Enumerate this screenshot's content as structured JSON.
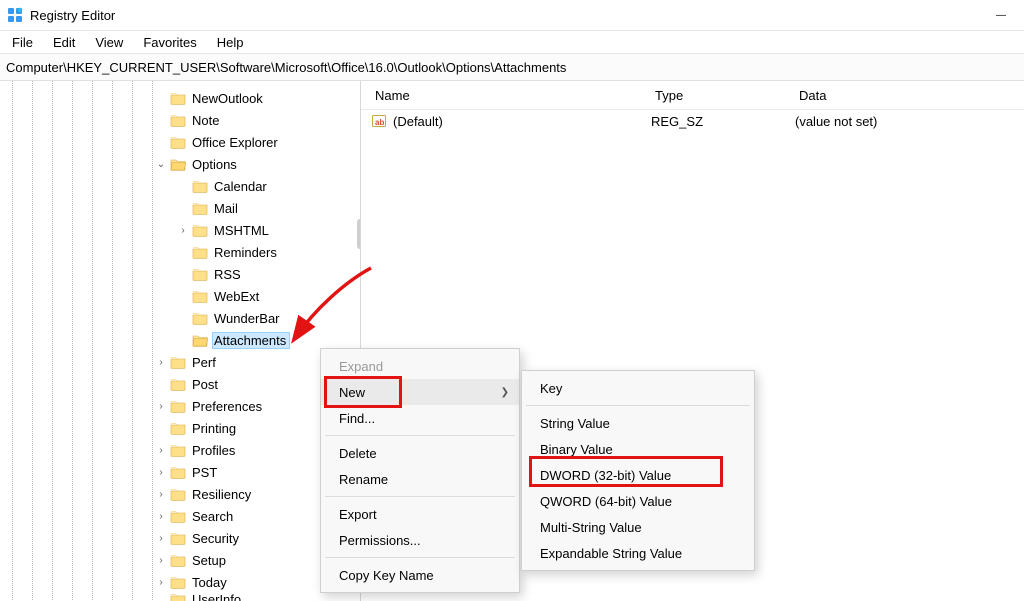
{
  "window": {
    "title": "Registry Editor"
  },
  "menubar": {
    "file": "File",
    "edit": "Edit",
    "view": "View",
    "favorites": "Favorites",
    "help": "Help"
  },
  "address": "Computer\\HKEY_CURRENT_USER\\Software\\Microsoft\\Office\\16.0\\Outlook\\Options\\Attachments",
  "tree": {
    "items": [
      {
        "label": "NewOutlook",
        "indent": 168,
        "exp": ""
      },
      {
        "label": "Note",
        "indent": 168,
        "exp": ""
      },
      {
        "label": "Office Explorer",
        "indent": 168,
        "exp": ""
      },
      {
        "label": "Options",
        "indent": 168,
        "exp": "v",
        "open": true
      },
      {
        "label": "Calendar",
        "indent": 190,
        "exp": ""
      },
      {
        "label": "Mail",
        "indent": 190,
        "exp": ""
      },
      {
        "label": "MSHTML",
        "indent": 190,
        "exp": ">"
      },
      {
        "label": "Reminders",
        "indent": 190,
        "exp": ""
      },
      {
        "label": "RSS",
        "indent": 190,
        "exp": ""
      },
      {
        "label": "WebExt",
        "indent": 190,
        "exp": ""
      },
      {
        "label": "WunderBar",
        "indent": 190,
        "exp": ""
      },
      {
        "label": "Attachments",
        "indent": 190,
        "exp": "",
        "selected": true
      },
      {
        "label": "Perf",
        "indent": 168,
        "exp": ">"
      },
      {
        "label": "Post",
        "indent": 168,
        "exp": ""
      },
      {
        "label": "Preferences",
        "indent": 168,
        "exp": ">"
      },
      {
        "label": "Printing",
        "indent": 168,
        "exp": ""
      },
      {
        "label": "Profiles",
        "indent": 168,
        "exp": ">"
      },
      {
        "label": "PST",
        "indent": 168,
        "exp": ">"
      },
      {
        "label": "Resiliency",
        "indent": 168,
        "exp": ">"
      },
      {
        "label": "Search",
        "indent": 168,
        "exp": ">"
      },
      {
        "label": "Security",
        "indent": 168,
        "exp": ">"
      },
      {
        "label": "Setup",
        "indent": 168,
        "exp": ">"
      },
      {
        "label": "Today",
        "indent": 168,
        "exp": ">"
      },
      {
        "label": "UserInfo",
        "indent": 168,
        "exp": "",
        "cut": true
      }
    ]
  },
  "details": {
    "header": {
      "name": "Name",
      "type": "Type",
      "data": "Data"
    },
    "rows": [
      {
        "name": "(Default)",
        "type": "REG_SZ",
        "data": "(value not set)"
      }
    ]
  },
  "ctx1": {
    "expand": "Expand",
    "new": "New",
    "find": "Find...",
    "delete": "Delete",
    "rename": "Rename",
    "export": "Export",
    "permissions": "Permissions...",
    "copykey": "Copy Key Name"
  },
  "ctx2": {
    "key": "Key",
    "string": "String Value",
    "binary": "Binary Value",
    "dword": "DWORD (32-bit) Value",
    "qword": "QWORD (64-bit) Value",
    "multi": "Multi-String Value",
    "expand": "Expandable String Value"
  }
}
